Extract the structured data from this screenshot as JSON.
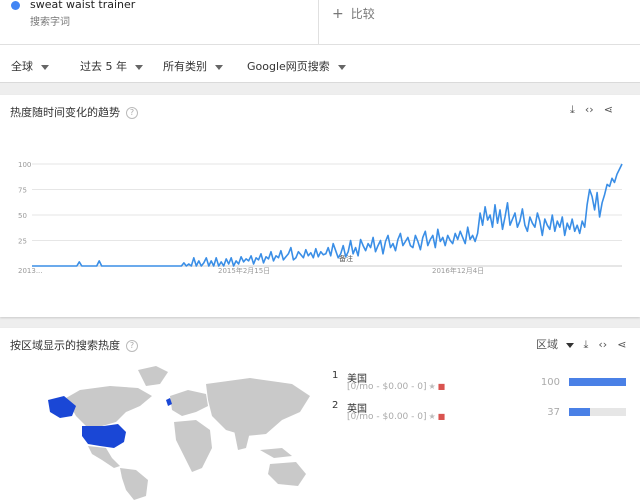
{
  "term": {
    "name": "sweat waist trainer",
    "type": "搜索字词",
    "color": "#4285f4"
  },
  "compare": {
    "icon": "plus-icon",
    "label": "比较"
  },
  "filters": [
    "全球",
    "过去 5 年",
    "所有类别",
    "Google网页搜索"
  ],
  "interest_over_time": {
    "title": "热度随时间变化的趋势",
    "actions": [
      "download-icon",
      "embed-icon",
      "share-icon"
    ]
  },
  "region_section": {
    "title": "按区域显示的搜索热度",
    "resolution_label": "区域",
    "actions": [
      "download-icon",
      "embed-icon",
      "share-icon"
    ],
    "map_highlight_color": "#1a47d6",
    "rows": [
      {
        "rank": "1",
        "name": "美国",
        "sub": "[0/mo - $0.00 - 0]",
        "value": "100",
        "fraction": 1.0
      },
      {
        "rank": "2",
        "name": "英国",
        "sub": "[0/mo - $0.00 - 0]",
        "value": "37",
        "fraction": 0.37
      }
    ]
  },
  "chart_data": {
    "type": "line",
    "yticks": [
      "100",
      "75",
      "50",
      "25"
    ],
    "xticks": [
      "2013...",
      "2015年2月15日",
      "2016年12月4日"
    ],
    "annotation": "备注",
    "ylim": [
      0,
      100
    ],
    "grid": true,
    "series": [
      {
        "color": "#3a8ee6",
        "values": [
          0,
          0,
          0,
          0,
          0,
          0,
          0,
          0,
          0,
          0,
          0,
          0,
          0,
          0,
          0,
          0,
          0,
          0,
          0,
          4,
          0,
          0,
          0,
          0,
          0,
          0,
          0,
          5,
          0,
          0,
          0,
          0,
          0,
          0,
          0,
          0,
          0,
          0,
          0,
          0,
          0,
          0,
          0,
          0,
          0,
          0,
          0,
          0,
          0,
          0,
          0,
          0,
          0,
          0,
          0,
          0,
          0,
          0,
          0,
          0,
          0,
          3,
          0,
          2,
          0,
          8,
          0,
          5,
          0,
          3,
          8,
          0,
          5,
          0,
          8,
          0,
          4,
          0,
          7,
          2,
          8,
          0,
          5,
          2,
          9,
          4,
          7,
          5,
          10,
          2,
          8,
          6,
          12,
          3,
          9,
          7,
          14,
          5,
          10,
          8,
          15,
          6,
          9,
          12,
          18,
          6,
          8,
          14,
          11,
          8,
          16,
          10,
          13,
          8,
          17,
          9,
          14,
          11,
          12,
          18,
          10,
          22,
          15,
          8,
          12,
          20,
          9,
          14,
          25,
          12,
          18,
          10,
          26,
          20,
          15,
          22,
          18,
          28,
          14,
          20,
          25,
          12,
          24,
          30,
          18,
          22,
          15,
          26,
          32,
          20,
          24,
          28,
          20,
          18,
          30,
          24,
          16,
          28,
          34,
          20,
          26,
          30,
          18,
          36,
          24,
          28,
          20,
          30,
          25,
          22,
          32,
          26,
          34,
          28,
          22,
          38,
          26,
          30,
          24,
          32,
          52,
          40,
          58,
          45,
          50,
          38,
          60,
          42,
          55,
          36,
          48,
          62,
          40,
          46,
          52,
          38,
          44,
          56,
          40,
          34,
          48,
          42,
          38,
          52,
          44,
          30,
          46,
          40,
          36,
          50,
          34,
          44,
          38,
          48,
          30,
          42,
          36,
          46,
          34,
          40,
          32,
          44,
          38,
          60,
          75,
          68,
          55,
          72,
          48,
          62,
          70,
          80,
          78,
          86,
          82,
          90,
          95,
          100
        ]
      }
    ]
  }
}
